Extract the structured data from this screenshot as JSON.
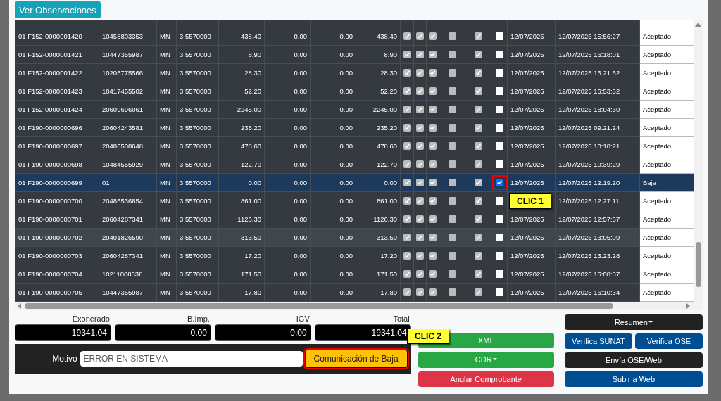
{
  "top_button": "Ver Observaciones",
  "rows": [
    {
      "doc": "01 F152-0000001420",
      "ruc": "10458803353",
      "currency": "MN",
      "rate": "3.5570000",
      "amount_1": "438.40",
      "amount_2": "0.00",
      "amount_3": "0.00",
      "total": "438.40",
      "flags": [
        true,
        true,
        true,
        false,
        true
      ],
      "checked": false,
      "date": "12/07/2025",
      "datetime": "12/07/2025 15:56:27",
      "status": "Aceptado",
      "selected": false,
      "hovered": false
    },
    {
      "doc": "01 F152-0000001421",
      "ruc": "10447355987",
      "currency": "MN",
      "rate": "3.5570000",
      "amount_1": "8.90",
      "amount_2": "0.00",
      "amount_3": "0.00",
      "total": "8.90",
      "flags": [
        true,
        true,
        true,
        false,
        true
      ],
      "checked": false,
      "date": "12/07/2025",
      "datetime": "12/07/2025 16:18:01",
      "status": "Aceptado",
      "selected": false,
      "hovered": false
    },
    {
      "doc": "01 F152-0000001422",
      "ruc": "10205775566",
      "currency": "MN",
      "rate": "3.5570000",
      "amount_1": "28.30",
      "amount_2": "0.00",
      "amount_3": "0.00",
      "total": "28.30",
      "flags": [
        true,
        true,
        true,
        false,
        true
      ],
      "checked": false,
      "date": "12/07/2025",
      "datetime": "12/07/2025 16:21:52",
      "status": "Aceptado",
      "selected": false,
      "hovered": false
    },
    {
      "doc": "01 F152-0000001423",
      "ruc": "10417455502",
      "currency": "MN",
      "rate": "3.5570000",
      "amount_1": "52.20",
      "amount_2": "0.00",
      "amount_3": "0.00",
      "total": "52.20",
      "flags": [
        true,
        true,
        true,
        false,
        true
      ],
      "checked": false,
      "date": "12/07/2025",
      "datetime": "12/07/2025 16:53:52",
      "status": "Aceptado",
      "selected": false,
      "hovered": false
    },
    {
      "doc": "01 F152-0000001424",
      "ruc": "20609696061",
      "currency": "MN",
      "rate": "3.5570000",
      "amount_1": "2245.00",
      "amount_2": "0.00",
      "amount_3": "0.00",
      "total": "2245.00",
      "flags": [
        true,
        true,
        true,
        false,
        true
      ],
      "checked": false,
      "date": "12/07/2025",
      "datetime": "12/07/2025 18:04:30",
      "status": "Aceptado",
      "selected": false,
      "hovered": false
    },
    {
      "doc": "01 F190-0000000696",
      "ruc": "20604243581",
      "currency": "MN",
      "rate": "3.5570000",
      "amount_1": "235.20",
      "amount_2": "0.00",
      "amount_3": "0.00",
      "total": "235.20",
      "flags": [
        true,
        true,
        true,
        false,
        true
      ],
      "checked": false,
      "date": "12/07/2025",
      "datetime": "12/07/2025 09:21:24",
      "status": "Aceptado",
      "selected": false,
      "hovered": false
    },
    {
      "doc": "01 F190-0000000697",
      "ruc": "20486508648",
      "currency": "MN",
      "rate": "3.5570000",
      "amount_1": "478.60",
      "amount_2": "0.00",
      "amount_3": "0.00",
      "total": "478.60",
      "flags": [
        true,
        true,
        true,
        false,
        true
      ],
      "checked": false,
      "date": "12/07/2025",
      "datetime": "12/07/2025 10:18:21",
      "status": "Aceptado",
      "selected": false,
      "hovered": false
    },
    {
      "doc": "01 F190-0000000698",
      "ruc": "10484555929",
      "currency": "MN",
      "rate": "3.5570000",
      "amount_1": "122.70",
      "amount_2": "0.00",
      "amount_3": "0.00",
      "total": "122.70",
      "flags": [
        true,
        true,
        true,
        false,
        true
      ],
      "checked": false,
      "date": "12/07/2025",
      "datetime": "12/07/2025 10:39:29",
      "status": "Aceptado",
      "selected": false,
      "hovered": false
    },
    {
      "doc": "01 F190-0000000699",
      "ruc": "01",
      "currency": "MN",
      "rate": "3.5570000",
      "amount_1": "0.00",
      "amount_2": "0.00",
      "amount_3": "0.00",
      "total": "0.00",
      "flags": [
        true,
        true,
        true,
        false,
        true
      ],
      "checked": true,
      "highlighted": true,
      "date": "12/07/2025",
      "datetime": "12/07/2025 12:19:20",
      "status": "Baja",
      "selected": true,
      "hovered": false
    },
    {
      "doc": "01 F190-0000000700",
      "ruc": "20486536854",
      "currency": "MN",
      "rate": "3.5570000",
      "amount_1": "861.00",
      "amount_2": "0.00",
      "amount_3": "0.00",
      "total": "861.00",
      "flags": [
        true,
        true,
        true,
        false,
        true
      ],
      "checked": false,
      "callout": "CLIC 1",
      "datetime": "12/07/2025 12:27:11",
      "status": "Aceptado",
      "selected": false,
      "hovered": false
    },
    {
      "doc": "01 F190-0000000701",
      "ruc": "20604287341",
      "currency": "MN",
      "rate": "3.5570000",
      "amount_1": "1126.30",
      "amount_2": "0.00",
      "amount_3": "0.00",
      "total": "1126.30",
      "flags": [
        true,
        true,
        true,
        false,
        true
      ],
      "checked": false,
      "date": "12/07/2025",
      "datetime": "12/07/2025 12:57:57",
      "status": "Aceptado",
      "selected": false,
      "hovered": false
    },
    {
      "doc": "01 F190-0000000702",
      "ruc": "20401826590",
      "currency": "MN",
      "rate": "3.5570000",
      "amount_1": "313.50",
      "amount_2": "0.00",
      "amount_3": "0.00",
      "total": "313.50",
      "flags": [
        true,
        true,
        true,
        false,
        true
      ],
      "checked": false,
      "date": "12/07/2025",
      "datetime": "12/07/2025 13:05:09",
      "status": "Aceptado",
      "selected": false,
      "hovered": true
    },
    {
      "doc": "01 F190-0000000703",
      "ruc": "20604287341",
      "currency": "MN",
      "rate": "3.5570000",
      "amount_1": "17.20",
      "amount_2": "0.00",
      "amount_3": "0.00",
      "total": "17.20",
      "flags": [
        true,
        true,
        true,
        false,
        true
      ],
      "checked": false,
      "date": "12/07/2025",
      "datetime": "12/07/2025 13:23:28",
      "status": "Aceptado",
      "selected": false,
      "hovered": false
    },
    {
      "doc": "01 F190-0000000704",
      "ruc": "10211088538",
      "currency": "MN",
      "rate": "3.5570000",
      "amount_1": "171.50",
      "amount_2": "0.00",
      "amount_3": "0.00",
      "total": "171.50",
      "flags": [
        true,
        true,
        true,
        false,
        true
      ],
      "checked": false,
      "date": "12/07/2025",
      "datetime": "12/07/2025 15:08:37",
      "status": "Aceptado",
      "selected": false,
      "hovered": false
    },
    {
      "doc": "01 F190-0000000705",
      "ruc": "10447355987",
      "currency": "MN",
      "rate": "3.5570000",
      "amount_1": "17.80",
      "amount_2": "0.00",
      "amount_3": "0.00",
      "total": "17.80",
      "flags": [
        true,
        true,
        true,
        false,
        true
      ],
      "checked": false,
      "date": "12/07/2025",
      "datetime": "12/07/2025 16:10:34",
      "status": "Aceptado",
      "selected": false,
      "hovered": false
    }
  ],
  "totals": [
    {
      "label": "Exonerado",
      "value": "19341.04"
    },
    {
      "label": "B.Imp.",
      "value": "0.00"
    },
    {
      "label": "IGV",
      "value": "0.00"
    },
    {
      "label": "Total",
      "value": "19341.04"
    }
  ],
  "motivo": {
    "label": "Motivo",
    "value": "ERROR EN SISTEMA"
  },
  "baja_button": {
    "label": "Comunicación de Baja",
    "highlighted": true
  },
  "callout_2": "CLIC 2",
  "middle_buttons": [
    {
      "label": "XML",
      "kind": "success",
      "dropdown": false
    },
    {
      "label": "CDR",
      "kind": "success",
      "dropdown": true
    },
    {
      "label": "Anular Comprobante",
      "kind": "danger",
      "dropdown": false
    }
  ],
  "right_buttons": [
    [
      {
        "label": "Resumen",
        "kind": "dark",
        "dropdown": true
      }
    ],
    [
      {
        "label": "Verifica SUNAT",
        "kind": "primary",
        "dropdown": false
      },
      {
        "label": "Verifica OSE",
        "kind": "primary",
        "dropdown": false
      }
    ],
    [
      {
        "label": "Envía OSE/Web",
        "kind": "dark",
        "dropdown": false
      }
    ],
    [
      {
        "label": "Subir a Web",
        "kind": "primary",
        "dropdown": false
      }
    ]
  ]
}
